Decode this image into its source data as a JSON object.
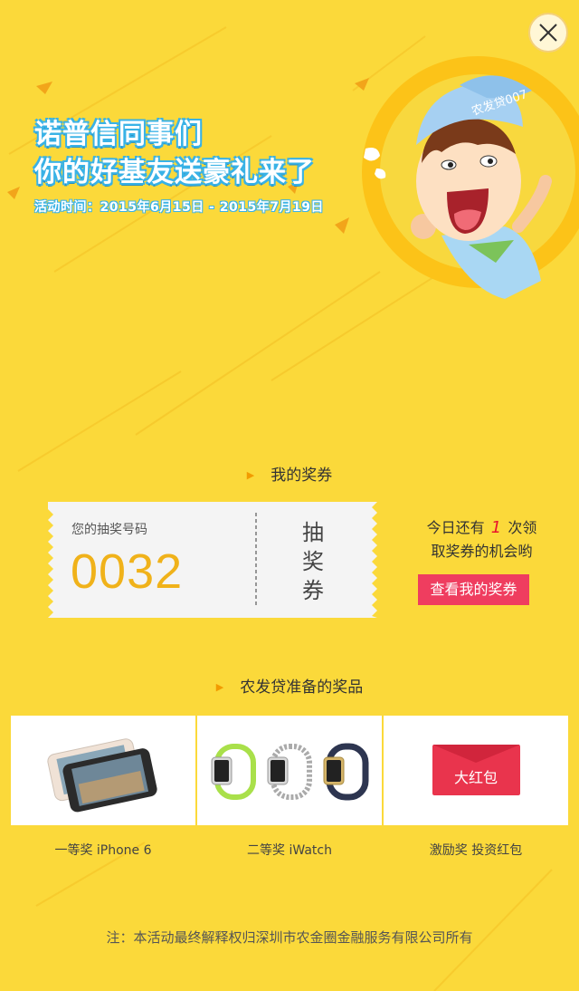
{
  "colors": {
    "background": "#fbd93a",
    "accent": "#ef3d5f",
    "number": "#f0b21a",
    "banner_outline": "#39b2e6"
  },
  "icons": {
    "close": "close-icon",
    "arrow": "triangle-right-icon"
  },
  "banner": {
    "line1": "诺普信同事们",
    "line2": "你的好基友送豪礼来了",
    "date": "活动时间：2015年6月15日 - 2015年7月19日"
  },
  "mascot": {
    "cap_text": "农发贷007"
  },
  "my_vouchers": {
    "title": "我的奖券"
  },
  "ticket": {
    "label": "您的抽奖号码",
    "number": "0032",
    "stub_chars": [
      "抽",
      "奖",
      "券"
    ]
  },
  "notice": {
    "prefix": "今日还有",
    "count": "1",
    "suffix": "次领",
    "line2": "取奖券的机会哟"
  },
  "view_button": "查看我的奖券",
  "prizes": {
    "title": "农发贷准备的奖品",
    "items": [
      {
        "label": "一等奖  iPhone 6"
      },
      {
        "label": "二等奖  iWatch"
      },
      {
        "label": "激励奖    投资红包",
        "badge": "大红包"
      }
    ]
  },
  "footer": "注：本活动最终解释权归深圳市农金圈金融服务有限公司所有"
}
